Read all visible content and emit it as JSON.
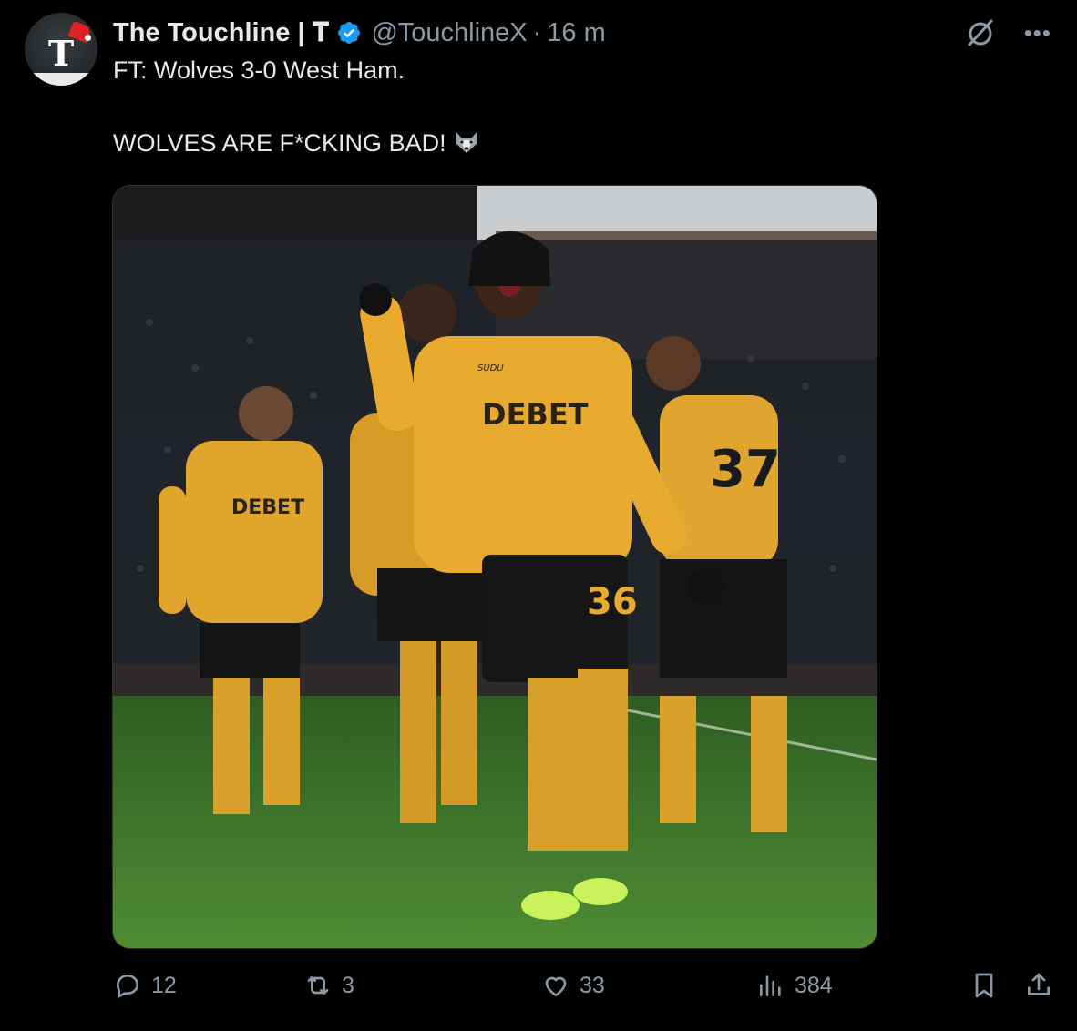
{
  "author": {
    "display_name": "The Touchline | 𝐓",
    "handle": "@TouchlineX",
    "separator": "·",
    "time": "16 m",
    "verified": true,
    "avatar_letter": "T"
  },
  "tweet": {
    "line1": "FT: Wolves 3-0 West Ham.",
    "line2": "WOLVES ARE F*CKING BAD!"
  },
  "image": {
    "sponsor": "DEBET",
    "kit_brand": "SUDU",
    "numbers": [
      "36",
      "37"
    ]
  },
  "actions": {
    "replies": "12",
    "reposts": "3",
    "likes": "33",
    "views": "384"
  },
  "icons": {
    "verified": "verified-badge-icon",
    "grok": "grok-icon",
    "more": "more-icon",
    "reply": "reply-icon",
    "repost": "repost-icon",
    "like": "like-icon",
    "views": "views-icon",
    "bookmark": "bookmark-icon",
    "share": "share-icon",
    "emoji": "wolf-emoji-icon"
  },
  "colors": {
    "background": "#000000",
    "text": "#e7e9ea",
    "secondary": "#8b98a5",
    "verified": "#1d9bf0",
    "wolves_gold": "#e2a52c"
  }
}
